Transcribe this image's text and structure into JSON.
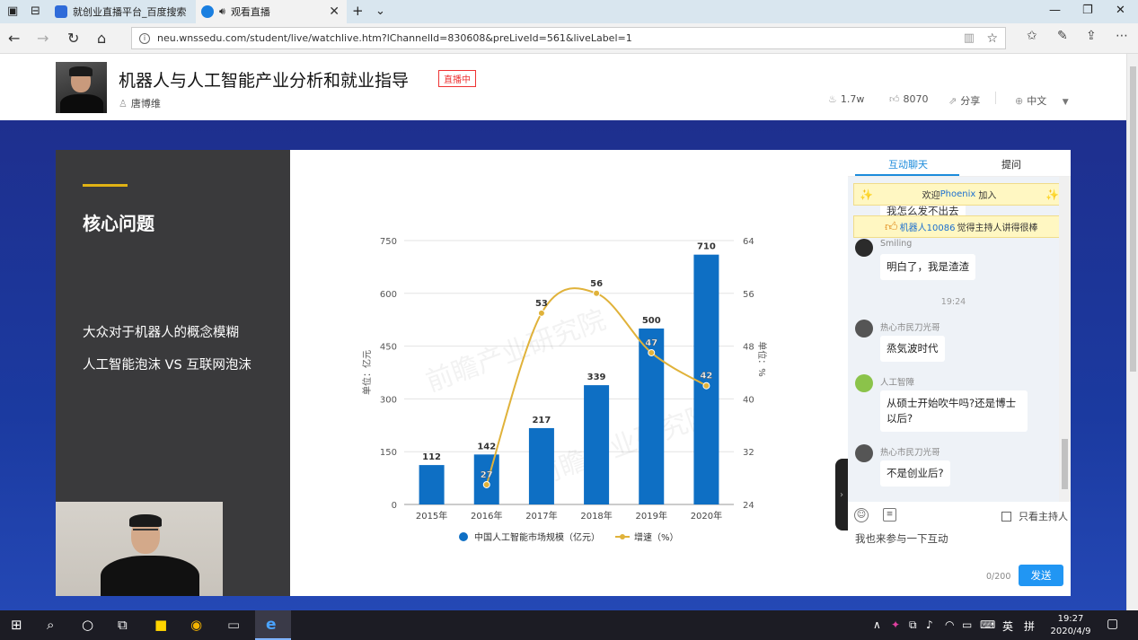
{
  "browser": {
    "tabs": [
      {
        "title": "就创业直播平台_百度搜索",
        "active": false
      },
      {
        "title": "观看直播",
        "active": true
      }
    ],
    "url": "neu.wnssedu.com/student/live/watchlive.htm?lChannelId=830608&preLiveId=561&liveLabel=1"
  },
  "header": {
    "title": "机器人与人工智能产业分析和就业指导",
    "live_badge": "直播中",
    "host": "唐博维",
    "views": "1.7w",
    "likes": "8070",
    "share": "分享",
    "language": "中文"
  },
  "slide": {
    "heading": "核心问题",
    "points": [
      "大众对于机器人的概念模糊",
      "人工智能泡沫 VS 互联网泡沫"
    ]
  },
  "chart_data": {
    "type": "bar",
    "categories": [
      "2015年",
      "2016年",
      "2017年",
      "2018年",
      "2019年",
      "2020年"
    ],
    "series": [
      {
        "name": "中国人工智能市场规模（亿元）",
        "type": "bar",
        "values": [
          112,
          142,
          217,
          339,
          500,
          710
        ],
        "color": "#0e6fc4"
      },
      {
        "name": "增速（%）",
        "type": "line",
        "values": [
          null,
          27,
          53,
          56,
          47,
          42
        ],
        "color": "#e0b23a"
      }
    ],
    "ylabel": "单位：亿元",
    "y2label": "单位：%",
    "ylim": [
      0,
      750
    ],
    "yticks": [
      0,
      150,
      300,
      450,
      600,
      750
    ],
    "y2lim": [
      24,
      64
    ],
    "y2ticks": [
      24,
      32,
      40,
      48,
      56,
      64
    ],
    "grid": true,
    "legend": "bottom"
  },
  "chat": {
    "tabs": [
      "互动聊天",
      "提问"
    ],
    "notices": [
      {
        "prefix": "欢迎",
        "user": "Phoenix",
        "suffix": "加入"
      },
      {
        "prefix": "",
        "user": "机器人10086",
        "suffix": "觉得主持人讲得很棒"
      }
    ],
    "partial_message": "我怎么发不出去",
    "messages": [
      {
        "user": "Smiling",
        "text": "明白了，我是渣渣"
      },
      {
        "user": "热心市民刀光哥",
        "text": "烝気波时代"
      },
      {
        "user": "人工智障",
        "text": "从硕士开始吹牛吗?还是博士以后?"
      },
      {
        "user": "热心市民刀光哥",
        "text": "不是创业后?"
      }
    ],
    "time": "19:24",
    "host_only": "只看主持人",
    "input_placeholder": "我也来参与一下互动",
    "char_count": "0/200",
    "send": "发送"
  },
  "taskbar": {
    "ime": "英",
    "ime2": "拼",
    "time": "19:27",
    "date": "2020/4/9"
  }
}
